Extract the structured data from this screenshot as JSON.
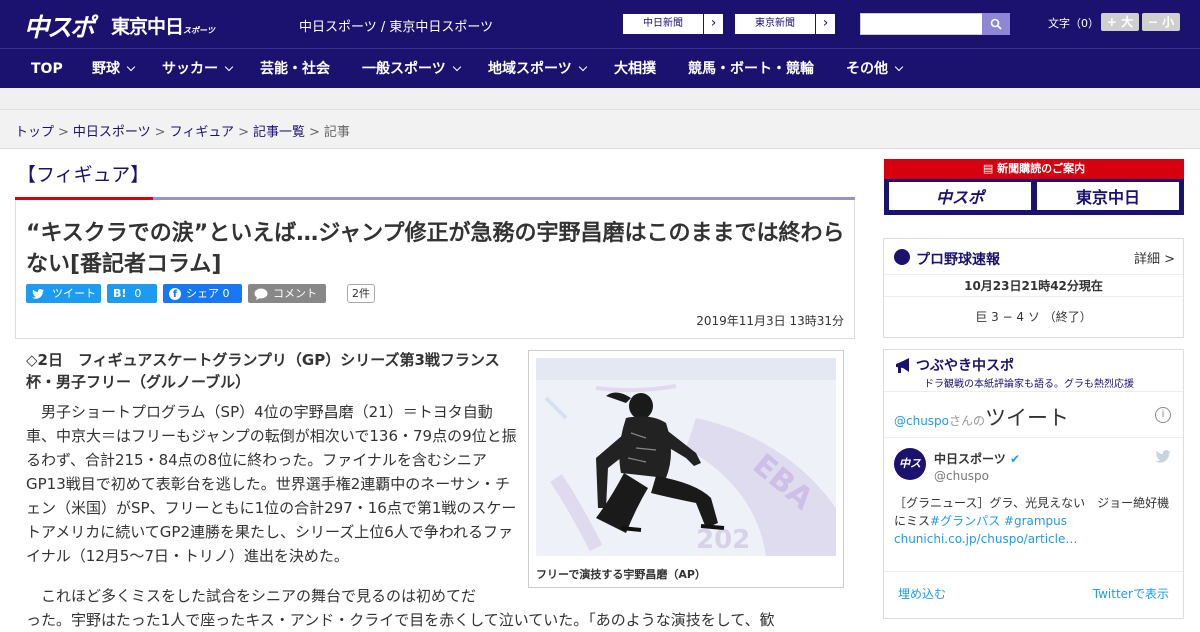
{
  "header": {
    "logo_chuspo": "中スポ",
    "logo_tokyo": "東京中日",
    "logo_tokyo_small": "スポーツ",
    "sites_text": "中日スポーツ / 東京中日スポーツ",
    "link_chunichi": "中日新聞",
    "link_tokyo": "東京新聞",
    "font_size_label": "文字（0）",
    "font_bigger": "+ 大",
    "font_smaller": "− 小"
  },
  "nav": [
    "TOP",
    "野球",
    "サッカー",
    "芸能・社会",
    "一般スポーツ",
    "地域スポーツ",
    "大相撲",
    "競馬・ボート・競輪",
    "その他"
  ],
  "breadcrumb": [
    "トップ",
    "中日スポーツ",
    "フィギュア",
    "記事一覧",
    "記事"
  ],
  "category": "【フィギュア】",
  "article": {
    "title": "“キスクラでの涙”といえば…ジャンプ修正が急務の宇野昌磨はこのままでは終わらない[番記者コラム]",
    "share": {
      "tweet": "ツイート",
      "hatena": "0",
      "facebook": "シェア 0",
      "comment": "コメント",
      "count": "2件"
    },
    "date": "2019年11月3日 13時31分",
    "lead": "◇2日　フィギュアスケートグランプリ（GP）シリーズ第3戦フランス杯・男子フリー（グルノーブル）",
    "p1": "男子ショートプログラム（SP）4位の宇野昌磨（21）＝トヨタ自動車、中京大＝はフリーもジャンプの転倒が相次いで136・79点の9位と振るわず、合計215・84点の8位に終わった。ファイナルを含むシニアGP13戦目で初めて表彰台を逃した。世界選手権2連覇中のネーサン・チェン（米国）がSP、フリーともに1位の合計297・16点で第1戦のスケートアメリカに続いてGP2連勝を果たし、シリーズ上位6人で争われるファイナル（12月5～7日・トリノ）進出を決めた。",
    "p2_line1": "これほど多くミスをした試合をシニアの舞台で見るのは初めてだ",
    "p2_line2": "った。宇野はたった1人で座ったキス・アンド・クライで目を赤くして泣いていた。「あのような演技をして、歓",
    "caption": "フリーで演技する宇野昌磨（AP）"
  },
  "sidebar": {
    "subscribe_head": "新聞購読のご案内",
    "subscribe_a": "中スポ",
    "subscribe_b": "東京中日",
    "pro_title": "プロ野球速報",
    "pro_more": "詳細 >",
    "pro_time": "10月23日21時42分現在",
    "pro_score": "巨 3 − 4 ソ （終了）",
    "tsu_title": "つぶやき中スポ",
    "tsu_sub": "ドラ観戦の本紙評論家も語る。グラも熱烈応援",
    "tw_handle_label": "@chuspo",
    "tw_san": "さんの",
    "tw_tweet": "ツイート",
    "tw_name": "中日スポーツ",
    "tw_handle": "@chuspo",
    "tw_text_a": "［グラニュース］グラ、光見えない　ジョー絶好機にミス",
    "tw_tag1": "#グランパス",
    "tw_tag2": "#grampus",
    "tw_link": "chunichi.co.jp/chuspo/article…",
    "tw_embed": "埋め込む",
    "tw_view": "Twitterで表示"
  },
  "colors": {
    "brand": "#1b1270",
    "accent_red": "#d7000f",
    "twitter": "#1d9bf0"
  }
}
